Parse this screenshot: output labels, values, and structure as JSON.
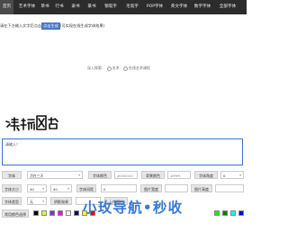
{
  "nav": {
    "items": [
      {
        "label": "首页"
      },
      {
        "label": "艺术字体"
      },
      {
        "label": "草书"
      },
      {
        "label": "行书"
      },
      {
        "label": "隶书"
      },
      {
        "label": "篆书"
      },
      {
        "label": "钢笔字"
      },
      {
        "label": "毛笔字"
      },
      {
        "label": "POP字体"
      },
      {
        "label": "英文字体"
      },
      {
        "label": "数字字体"
      },
      {
        "label": "全部字体"
      }
    ]
  },
  "tip": {
    "before": "请在下方输入文字后点击",
    "button": "点击生成",
    "after": "(可实现在线生成字体效果)"
  },
  "viewers": {
    "label": "深入探索:",
    "option1": "艺术",
    "option2": "在线艺术课程"
  },
  "preview": {
    "text": "请输入文字"
  },
  "textbox": {
    "placeholder": "请输入！"
  },
  "form": {
    "font_label": "字体",
    "font_value": "活在三天",
    "fg_label": "字体颜色",
    "fg_value": "#000000",
    "bg_label": "背景颜色",
    "bg_value": "#ffffff",
    "dir_label": "字体角度",
    "dir_value": "0",
    "size_label": "字体大小",
    "size_value": "40",
    "ab_value": "40",
    "spacing_label": "字体间距",
    "spacing_value": "0",
    "width_label": "图片宽度",
    "height_label": "图片高度",
    "shape_label": "字体类型",
    "shape_value": "无",
    "effect_label": "阴影效果",
    "image_label": "上传图片",
    "bgcolor_label": "常用颜色选择"
  },
  "swatch_colors": [
    "#000000",
    "#d8ff3c",
    "#8a2be2",
    "#ff00ff",
    "#ffffff",
    "#000080",
    "#ffff00",
    "#ff0000",
    "#00ff00",
    "#008000",
    "#00ffff",
    "#0000ff"
  ],
  "watermark": "小玫导航•秒收"
}
